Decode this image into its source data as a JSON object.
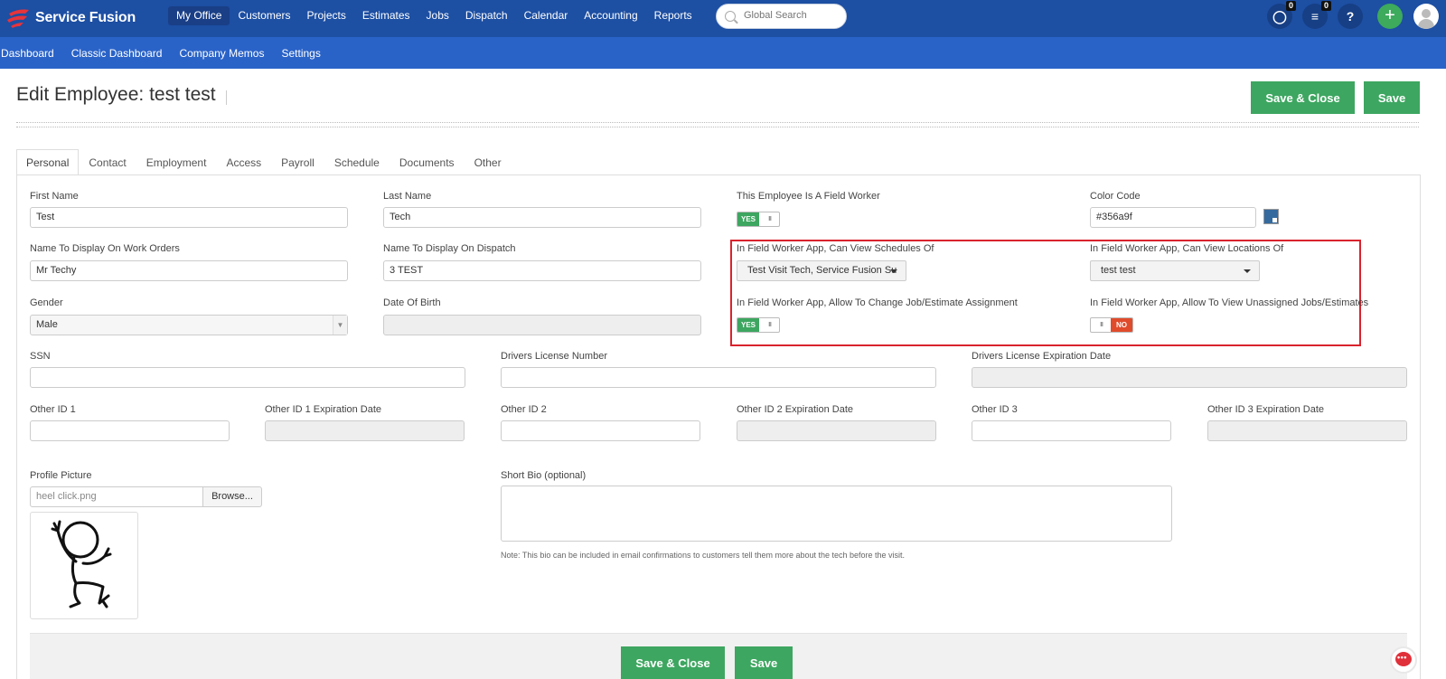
{
  "app": {
    "logo_text": "Service Fusion",
    "brand_color": "#1d4fa3",
    "accent_green": "#3da660",
    "accent_red": "#e04b2b"
  },
  "topnav": {
    "items": [
      "My Office",
      "Customers",
      "Projects",
      "Estimates",
      "Jobs",
      "Dispatch",
      "Calendar",
      "Accounting",
      "Reports"
    ],
    "active": "My Office",
    "search_placeholder": "Global Search",
    "chat_badge": "0",
    "tasks_badge": "0",
    "help_label": "?",
    "plus_label": "+"
  },
  "subnav": {
    "items": [
      "Dashboard",
      "Classic Dashboard",
      "Company Memos",
      "Settings"
    ]
  },
  "header": {
    "title": "Edit Employee: test test",
    "save_close_label": "Save & Close",
    "save_label": "Save"
  },
  "tabs": [
    "Personal",
    "Contact",
    "Employment",
    "Access",
    "Payroll",
    "Schedule",
    "Documents",
    "Other"
  ],
  "active_tab": "Personal",
  "form": {
    "first_name": {
      "label": "First Name",
      "value": "Test"
    },
    "last_name": {
      "label": "Last Name",
      "value": "Tech"
    },
    "field_worker": {
      "label": "This Employee Is A Field Worker",
      "on_label": "YES",
      "grip": "III"
    },
    "color_code": {
      "label": "Color Code",
      "value": "#356a9f",
      "swatch": "#356a9f"
    },
    "display_work_orders": {
      "label": "Name To Display On Work Orders",
      "value": "Mr Techy"
    },
    "display_dispatch": {
      "label": "Name To Display On Dispatch",
      "value": "3 TEST"
    },
    "view_schedules": {
      "label": "In Field Worker App, Can View Schedules Of",
      "value": "Test Visit Tech, Service Fusion Su"
    },
    "view_locations": {
      "label": "In Field Worker App, Can View Locations Of",
      "value": "test test"
    },
    "gender": {
      "label": "Gender",
      "value": "Male"
    },
    "dob": {
      "label": "Date Of Birth",
      "value": ""
    },
    "change_assignment": {
      "label": "In Field Worker App, Allow To Change Job/Estimate Assignment",
      "on_label": "YES",
      "grip": "III"
    },
    "view_unassigned": {
      "label": "In Field Worker App, Allow To View Unassigned Jobs/Estimates",
      "off_label": "NO",
      "grip": "III"
    },
    "ssn": {
      "label": "SSN",
      "value": ""
    },
    "drivers_license": {
      "label": "Drivers License Number",
      "value": ""
    },
    "dl_expiration": {
      "label": "Drivers License Expiration Date",
      "value": ""
    },
    "other_id1": {
      "label": "Other ID 1",
      "value": ""
    },
    "other_id1_exp": {
      "label": "Other ID 1 Expiration Date",
      "value": ""
    },
    "other_id2": {
      "label": "Other ID 2",
      "value": ""
    },
    "other_id2_exp": {
      "label": "Other ID 2 Expiration Date",
      "value": ""
    },
    "other_id3": {
      "label": "Other ID 3",
      "value": ""
    },
    "other_id3_exp": {
      "label": "Other ID 3 Expiration Date",
      "value": ""
    },
    "profile_picture": {
      "label": "Profile Picture",
      "file": "heel click.png",
      "browse_label": "Browse..."
    },
    "short_bio": {
      "label": "Short Bio (optional)",
      "value": "",
      "note": "Note: This bio can be included in email confirmations to customers tell them more about the tech before the visit."
    }
  },
  "footer": {
    "save_close_label": "Save & Close",
    "save_label": "Save"
  },
  "chat_widget": {
    "icon": "chat-support-icon",
    "dots": "•••"
  }
}
